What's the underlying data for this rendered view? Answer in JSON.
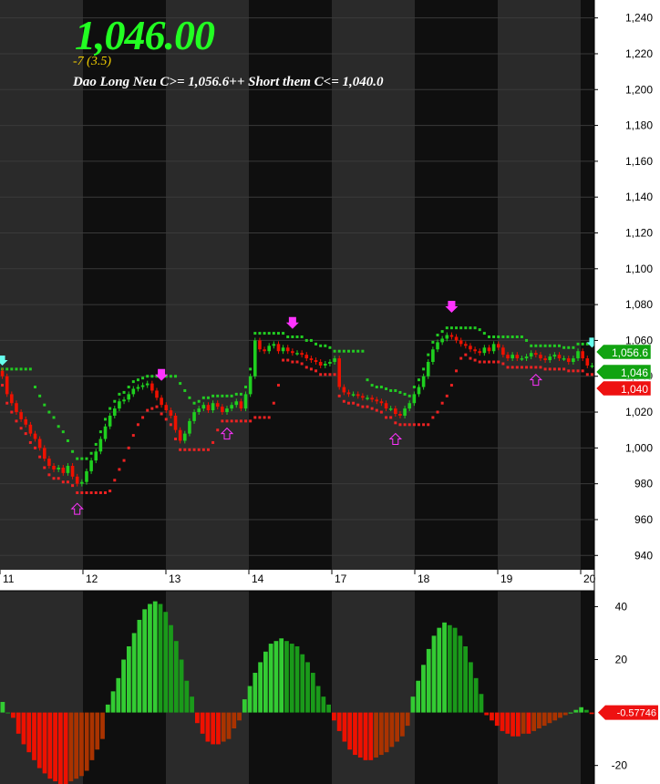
{
  "header": {
    "last_price": "1,046.00",
    "change": "-7  (3.5)",
    "signal_text": "Dao Long Neu C>= 1,056.6++ Short them C<= 1,040.0"
  },
  "colors": {
    "up": "#1fcf1f",
    "down": "#ee1100",
    "band_light": "#2a2a2a",
    "band_dark": "#0f0f0f",
    "stop_long": "#22cc22",
    "stop_short": "#ee2222",
    "arrow_sell": "#ff33ff",
    "arrow_cyan": "#66ffee",
    "osc_up": "#33cc33",
    "osc_up_fade": "#1a9a1a",
    "osc_down": "#ee1100",
    "osc_down_fade": "#aa3300"
  },
  "chart_data": [
    {
      "type": "candlestick",
      "title": "",
      "x_ticks": [
        "11",
        "12",
        "13",
        "14",
        "17",
        "18",
        "19",
        "20"
      ],
      "ylim": [
        932,
        1250
      ],
      "y_ticks": [
        940,
        960,
        980,
        1000,
        1020,
        1040,
        1060,
        1080,
        1100,
        1120,
        1140,
        1160,
        1180,
        1200,
        1220,
        1240
      ],
      "y_tick_labels": [
        "940",
        "960",
        "980",
        "1,000",
        "1,020",
        "1,040",
        "1,060",
        "1,080",
        "1,100",
        "1,120",
        "1,140",
        "1,160",
        "1,180",
        "1,200",
        "1,220",
        "1,240"
      ],
      "bars_per_day": 18,
      "closes": [
        1040,
        1030,
        1025,
        1020,
        1016,
        1013,
        1008,
        1005,
        1000,
        994,
        990,
        988,
        989,
        986,
        990,
        984,
        980,
        981,
        987,
        993,
        998,
        1005,
        1012,
        1018,
        1022,
        1026,
        1027,
        1030,
        1033,
        1034,
        1035,
        1036,
        1032,
        1028,
        1024,
        1021,
        1018,
        1010,
        1004,
        1008,
        1015,
        1020,
        1022,
        1024,
        1021,
        1025,
        1023,
        1020,
        1022,
        1024,
        1026,
        1022,
        1030,
        1040,
        1060,
        1055,
        1054,
        1057,
        1058,
        1054,
        1056,
        1054,
        1053,
        1053,
        1052,
        1050,
        1049,
        1048,
        1046,
        1047,
        1048,
        1050,
        1034,
        1031,
        1030,
        1030,
        1029,
        1028,
        1028,
        1027,
        1026,
        1025,
        1022,
        1022,
        1019,
        1018,
        1022,
        1025,
        1030,
        1034,
        1040,
        1048,
        1055,
        1059,
        1061,
        1063,
        1062,
        1060,
        1058,
        1057,
        1055,
        1054,
        1053,
        1056,
        1054,
        1058,
        1056,
        1052,
        1050,
        1052,
        1050,
        1050,
        1051,
        1053,
        1052,
        1050,
        1049,
        1051,
        1052,
        1050,
        1050,
        1048,
        1050,
        1054,
        1050,
        1046,
        1046
      ],
      "last_close": 1046,
      "stop_long": 1056.6,
      "stop_short": 1040.0,
      "price_tags": [
        {
          "label": "1,056.6",
          "value": 1056.6,
          "color": "#11a311"
        },
        {
          "label": "1,046",
          "value": 1046,
          "color": "#11a311"
        },
        {
          "label": "1,040",
          "value": 1040,
          "color": "#ee1111"
        }
      ]
    },
    {
      "type": "bar",
      "title": "",
      "ylim": [
        -27,
        46
      ],
      "y_ticks": [
        40,
        20,
        -20
      ],
      "y_tick_labels": [
        "40",
        "20",
        "-20"
      ],
      "last_value_label": "-0.57746",
      "values": [
        4,
        0,
        -2,
        -8,
        -12,
        -15,
        -18,
        -21,
        -23,
        -25,
        -26,
        -27,
        -27,
        -26,
        -25,
        -24,
        -22,
        -18,
        -14,
        -10,
        3,
        8,
        13,
        20,
        25,
        30,
        35,
        39,
        41,
        42,
        41,
        38,
        33,
        27,
        20,
        12,
        6,
        -4,
        -8,
        -11,
        -12,
        -12,
        -11,
        -10,
        -6,
        -3,
        5,
        10,
        15,
        19,
        23,
        26,
        27,
        28,
        27,
        26,
        25,
        22,
        19,
        15,
        10,
        6,
        3,
        -3,
        -7,
        -11,
        -14,
        -16,
        -17,
        -18,
        -18,
        -17,
        -16,
        -15,
        -13,
        -11,
        -9,
        -5,
        6,
        12,
        18,
        24,
        29,
        32,
        34,
        33,
        32,
        29,
        25,
        19,
        13,
        7,
        -1,
        -3,
        -5,
        -7,
        -8,
        -9,
        -9,
        -8,
        -8,
        -7,
        -6,
        -5,
        -4,
        -3,
        -2,
        -1,
        0,
        1,
        2,
        1,
        -0.58
      ]
    }
  ]
}
